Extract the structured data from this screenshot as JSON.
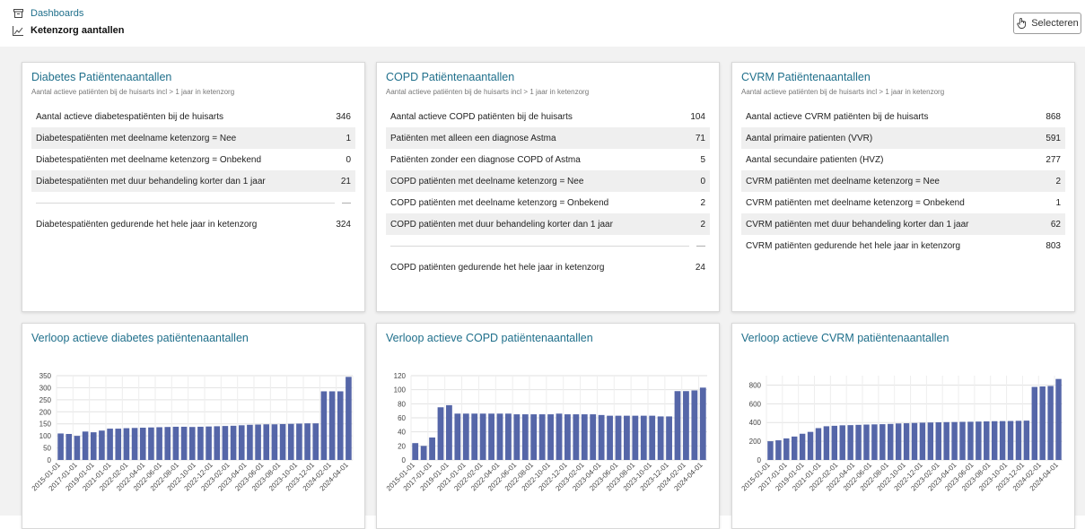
{
  "header": {
    "breadcrumb_root": "Dashboards",
    "breadcrumb_current": "Ketenzorg aantallen",
    "select_label": "Selecteren"
  },
  "colors": {
    "accent": "#1f6f8b",
    "bar": "#5566a8"
  },
  "cards": [
    {
      "title": "Diabetes Patiëntenaantallen",
      "subtitle": "Aantal actieve patiënten bij de huisarts incl > 1 jaar in ketenzorg",
      "rows": [
        {
          "label": "Aantal actieve diabetespatiënten bij de huisarts",
          "value": "346"
        },
        {
          "label": "Diabetespatiënten met deelname ketenzorg = Nee",
          "value": "1"
        },
        {
          "label": "Diabetespatiënten met deelname ketenzorg = Onbekend",
          "value": "0"
        },
        {
          "label": "Diabetespatiënten met duur behandeling korter dan 1 jaar",
          "value": "21"
        },
        {
          "label": "",
          "value": "—"
        },
        {
          "label": "Diabetespatiënten gedurende het hele jaar in ketenzorg",
          "value": "324"
        }
      ]
    },
    {
      "title": "COPD Patiëntenaantallen",
      "subtitle": "Aantal actieve patiënten bij de huisarts incl > 1 jaar in ketenzorg",
      "rows": [
        {
          "label": "Aantal actieve COPD patiënten bij de huisarts",
          "value": "104"
        },
        {
          "label": "Patiënten met alleen een diagnose Astma",
          "value": "71"
        },
        {
          "label": "Patiënten zonder een diagnose COPD of Astma",
          "value": "5"
        },
        {
          "label": "COPD patiënten met deelname ketenzorg = Nee",
          "value": "0"
        },
        {
          "label": "COPD patiënten met deelname ketenzorg = Onbekend",
          "value": "2"
        },
        {
          "label": "COPD patiënten met duur behandeling korter dan 1 jaar",
          "value": "2"
        },
        {
          "label": "",
          "value": "—"
        },
        {
          "label": "COPD patiënten gedurende het hele jaar in ketenzorg",
          "value": "24"
        }
      ]
    },
    {
      "title": "CVRM Patiëntenaantallen",
      "subtitle": "Aantal actieve patiënten bij de huisarts incl > 1 jaar in ketenzorg",
      "rows": [
        {
          "label": "Aantal actieve CVRM patiënten bij de huisarts",
          "value": "868"
        },
        {
          "label": "Aantal primaire patienten (VVR)",
          "value": "591"
        },
        {
          "label": "Aantal secundaire patienten (HVZ)",
          "value": "277"
        },
        {
          "label": "CVRM patiënten met deelname ketenzorg = Nee",
          "value": "2"
        },
        {
          "label": "CVRM patiënten met deelname ketenzorg = Onbekend",
          "value": "1"
        },
        {
          "label": "CVRM patiënten met duur behandeling korter dan 1 jaar",
          "value": "62"
        },
        {
          "label": "CVRM patiënten gedurende het hele jaar in ketenzorg",
          "value": "803"
        }
      ]
    }
  ],
  "chart_titles": [
    "Verloop actieve diabetes patiëntenaantallen",
    "Verloop actieve COPD patiëntenaantallen",
    "Verloop actieve CVRM patiëntenaantallen"
  ],
  "chart_data": [
    {
      "type": "bar",
      "title": "Verloop actieve diabetes patiëntenaantallen",
      "ylim": [
        0,
        350
      ],
      "yticks": [
        0,
        50,
        100,
        150,
        200,
        250,
        300,
        350
      ],
      "xtick_labels": [
        "2015-01-01",
        "2017-01-01",
        "2019-01-01",
        "2021-01-01",
        "2022-02-01",
        "2022-04-01",
        "2022-06-01",
        "2022-08-01",
        "2022-10-01",
        "2022-12-01",
        "2023-02-01",
        "2023-04-01",
        "2023-06-01",
        "2023-08-01",
        "2023-10-01",
        "2023-12-01",
        "2024-02-01",
        "2024-04-01"
      ],
      "values": [
        110,
        108,
        100,
        118,
        115,
        122,
        130,
        130,
        132,
        133,
        134,
        135,
        136,
        137,
        138,
        138,
        137,
        138,
        139,
        140,
        141,
        142,
        144,
        146,
        147,
        148,
        148,
        149,
        150,
        151,
        152,
        152,
        285,
        285,
        285,
        345
      ],
      "grid": true
    },
    {
      "type": "bar",
      "title": "Verloop actieve COPD patiëntenaantallen",
      "ylim": [
        0,
        120
      ],
      "yticks": [
        0,
        20,
        40,
        60,
        80,
        100,
        120
      ],
      "xtick_labels": [
        "2015-01-01",
        "2017-01-01",
        "2019-01-01",
        "2021-01-01",
        "2022-02-01",
        "2022-04-01",
        "2022-06-01",
        "2022-08-01",
        "2022-10-01",
        "2022-12-01",
        "2023-02-01",
        "2023-04-01",
        "2023-06-01",
        "2023-08-01",
        "2023-10-01",
        "2023-12-01",
        "2024-02-01",
        "2024-04-01"
      ],
      "values": [
        24,
        20,
        32,
        75,
        78,
        66,
        66,
        66,
        66,
        66,
        66,
        66,
        65,
        65,
        65,
        65,
        65,
        66,
        65,
        65,
        65,
        65,
        64,
        63,
        63,
        63,
        63,
        63,
        63,
        62,
        62,
        98,
        98,
        99,
        103
      ],
      "grid": true
    },
    {
      "type": "bar",
      "title": "Verloop actieve CVRM patiëntenaantallen",
      "ylim": [
        0,
        900
      ],
      "yticks": [
        0,
        200,
        400,
        600,
        800
      ],
      "xtick_labels": [
        "2015-01-01",
        "2017-01-01",
        "2019-01-01",
        "2021-01-01",
        "2022-02-01",
        "2022-04-01",
        "2022-06-01",
        "2022-08-01",
        "2022-10-01",
        "2022-12-01",
        "2023-02-01",
        "2023-04-01",
        "2023-06-01",
        "2023-08-01",
        "2023-10-01",
        "2023-12-01",
        "2024-02-01",
        "2024-04-01"
      ],
      "values": [
        200,
        210,
        230,
        250,
        280,
        300,
        340,
        360,
        365,
        370,
        372,
        375,
        378,
        380,
        382,
        385,
        390,
        392,
        395,
        398,
        400,
        402,
        404,
        405,
        407,
        408,
        410,
        412,
        414,
        415,
        416,
        418,
        420,
        780,
        785,
        790,
        865
      ],
      "grid": true
    }
  ]
}
